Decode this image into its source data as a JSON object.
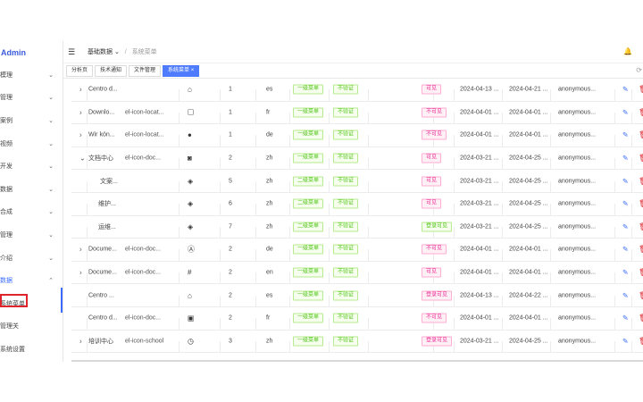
{
  "brand": "Admin",
  "sidebar": {
    "items": [
      {
        "label": "模理",
        "arrow": "⌄"
      },
      {
        "label": "管理",
        "arrow": "⌄"
      },
      {
        "label": "案例",
        "arrow": "⌄"
      },
      {
        "label": "视频",
        "arrow": "⌄"
      },
      {
        "label": "开发",
        "arrow": "⌄"
      },
      {
        "label": "数据",
        "arrow": "⌄"
      },
      {
        "label": "合成",
        "arrow": "⌄"
      },
      {
        "label": "管理",
        "arrow": "⌄"
      },
      {
        "label": "介绍",
        "arrow": "⌄"
      },
      {
        "label": "数据",
        "arrow": "⌃"
      },
      {
        "label": "系统菜单",
        "arrow": ""
      },
      {
        "label": "管理关",
        "arrow": ""
      },
      {
        "label": "系统设置",
        "arrow": ""
      }
    ]
  },
  "header": {
    "crumb_parent": "基础数据",
    "crumb_parent_arrow": "⌄",
    "crumb_sep": "/",
    "crumb_current": "系统菜单",
    "hamburger": "☰",
    "bell": "🔔"
  },
  "tags": [
    "分析页",
    "技术通知",
    "文件管理",
    "系统菜单 ×"
  ],
  "tags_refresh": "⟳",
  "rows": [
    {
      "exp": "›",
      "name": "Centro d...",
      "icon": "",
      "sym": "⌂",
      "sort": "1",
      "lang": "es",
      "lvl": "一级菜单",
      "auth": "不验证",
      "vis": "可见",
      "vis_color": "pink",
      "cdate": "2024-04-13 ...",
      "udate": "2024-04-21 ...",
      "user": "anonymous..."
    },
    {
      "exp": "›",
      "name": "Downlo...",
      "icon": "el-icon-locat...",
      "sym": "☐",
      "sort": "1",
      "lang": "fr",
      "lvl": "一级菜单",
      "auth": "不验证",
      "vis": "不可见",
      "vis_color": "pink",
      "cdate": "2024-04-01 ...",
      "udate": "2024-04-01 ...",
      "user": "anonymous..."
    },
    {
      "exp": "›",
      "name": "Wir kön...",
      "icon": "el-icon-locat...",
      "sym": "●",
      "sort": "1",
      "lang": "de",
      "lvl": "一级菜单",
      "auth": "不验证",
      "vis": "不可见",
      "vis_color": "pink",
      "cdate": "2024-04-01 ...",
      "udate": "2024-04-01 ...",
      "user": "anonymous..."
    },
    {
      "exp": "⌄",
      "name": "文档中心",
      "icon": "el-icon-doc...",
      "sym": "◙",
      "sort": "2",
      "lang": "zh",
      "lvl": "一级菜单",
      "auth": "不验证",
      "vis": "可见",
      "vis_color": "pink",
      "cdate": "2024-03-21 ...",
      "udate": "2024-04-25 ...",
      "user": "anonymous..."
    },
    {
      "exp": "",
      "name": "文案...",
      "icon": "",
      "sym": "◈",
      "sort": "5",
      "lang": "zh",
      "lvl": "二级菜单",
      "auth": "不验证",
      "vis": "可见",
      "vis_color": "pink",
      "cdate": "2024-03-21 ...",
      "udate": "2024-04-25 ...",
      "user": "anonymous..."
    },
    {
      "exp": "",
      "name": "维护...",
      "icon": "",
      "sym": "◈",
      "sort": "6",
      "lang": "zh",
      "lvl": "二级菜单",
      "auth": "不验证",
      "vis": "可见",
      "vis_color": "pink",
      "cdate": "2024-03-21 ...",
      "udate": "2024-04-25 ...",
      "user": "anonymous..."
    },
    {
      "exp": "",
      "name": "运维...",
      "icon": "",
      "sym": "◈",
      "sort": "7",
      "lang": "zh",
      "lvl": "二级菜单",
      "auth": "不验证",
      "vis": "登录可见",
      "vis_color": "green",
      "cdate": "2024-03-21 ...",
      "udate": "2024-04-25 ...",
      "user": "anonymous..."
    },
    {
      "exp": "›",
      "name": "Docume...",
      "icon": "el-icon-doc...",
      "sym": "Ⓐ",
      "sort": "2",
      "lang": "de",
      "lvl": "一级菜单",
      "auth": "不验证",
      "vis": "不可见",
      "vis_color": "pink",
      "cdate": "2024-04-01 ...",
      "udate": "2024-04-01 ...",
      "user": "anonymous..."
    },
    {
      "exp": "›",
      "name": "Docume...",
      "icon": "el-icon-doc...",
      "sym": "#",
      "sort": "2",
      "lang": "en",
      "lvl": "一级菜单",
      "auth": "不验证",
      "vis": "可见",
      "vis_color": "pink",
      "cdate": "2024-04-01 ...",
      "udate": "2024-04-01 ...",
      "user": "anonymous..."
    },
    {
      "exp": "",
      "name": "Centro ...",
      "icon": "",
      "sym": "⌂",
      "sort": "2",
      "lang": "es",
      "lvl": "一级菜单",
      "auth": "不验证",
      "vis": "登录可见",
      "vis_color": "pink",
      "cdate": "2024-04-13 ...",
      "udate": "2024-04-22 ...",
      "user": "anonymous..."
    },
    {
      "exp": "",
      "name": "Centro d...",
      "icon": "el-icon-doc...",
      "sym": "▣",
      "sort": "2",
      "lang": "fr",
      "lvl": "一级菜单",
      "auth": "不验证",
      "vis": "不可见",
      "vis_color": "pink",
      "cdate": "2024-04-01 ...",
      "udate": "2024-04-01 ...",
      "user": "anonymous..."
    },
    {
      "exp": "›",
      "name": "培训中心",
      "icon": "el-icon-school",
      "sym": "◷",
      "sort": "3",
      "lang": "zh",
      "lvl": "一级菜单",
      "auth": "不验证",
      "vis": "登录可见",
      "vis_color": "pink",
      "cdate": "2024-03-21 ...",
      "udate": "2024-04-25 ...",
      "user": "anonymous..."
    }
  ],
  "edit_icon": "✎",
  "delete_icon": "🗑",
  "colors": {
    "accent": "#3b6cff",
    "danger": "#e0242c",
    "green": "#52c41a",
    "pink": "#eb2f96"
  }
}
